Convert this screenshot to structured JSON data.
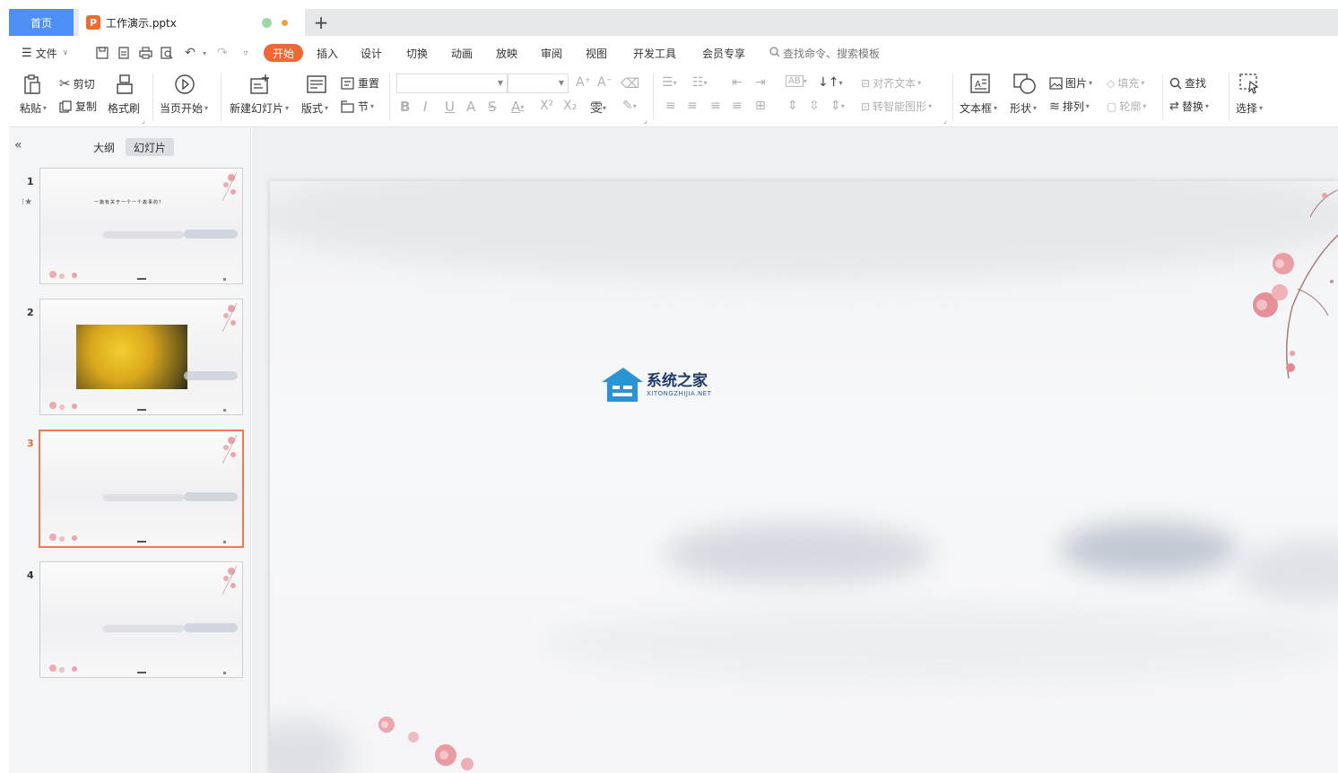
{
  "tabs": {
    "home": "首页",
    "file_name": "工作演示.pptx",
    "file_icon_letter": "P",
    "new_tab": "+"
  },
  "menu": {
    "file": "文件",
    "active_tab": "开始",
    "items": [
      "插入",
      "设计",
      "切换",
      "动画",
      "放映",
      "审阅",
      "视图",
      "开发工具",
      "会员专享"
    ],
    "search_placeholder": "查找命令、搜索模板"
  },
  "ribbon": {
    "paste": "粘贴",
    "cut": "剪切",
    "copy": "复制",
    "format_painter": "格式刷",
    "from_current": "当页开始",
    "new_slide": "新建幻灯片",
    "layout": "版式",
    "reset": "重置",
    "section": "节",
    "align_text": "对齐文本",
    "smartart": "转智能图形",
    "textbox": "文本框",
    "shape": "形状",
    "picture": "图片",
    "fill": "填充",
    "arrange": "排列",
    "outline": "轮廓",
    "find": "查找",
    "replace": "替换",
    "select": "选择"
  },
  "left_panel": {
    "outline_tab": "大纲",
    "slides_tab": "幻灯片",
    "slides": [
      {
        "number": "1",
        "title": "一篇有关于一个一个故事的？"
      },
      {
        "number": "2"
      },
      {
        "number": "3"
      },
      {
        "number": "4"
      }
    ]
  },
  "watermark": {
    "name": "系统之家",
    "url": "XITONGZHIJIA.NET"
  },
  "colors": {
    "accent": "#f06736",
    "home_tab": "#4d8ff5",
    "active_thumb_border": "#ee7a4d"
  }
}
